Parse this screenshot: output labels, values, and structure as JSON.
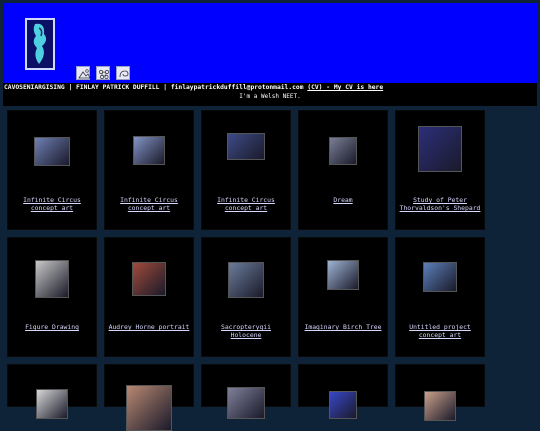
{
  "header": {
    "icons": [
      "landscape-icon",
      "flower-icon",
      "swirl-icon"
    ],
    "info": {
      "site": "CAVOSENIARGISING",
      "sep1": " | ",
      "name": "FINLAY PATRICK DUFFILL",
      "sep2": " | ",
      "email": "finlaypatrickduffill@protonmail.com",
      "cv_link": "(CV) - My CV is here"
    },
    "tagline": "I'm a Welsh NEET."
  },
  "gallery": [
    {
      "caption": "Infinite Circus concept art",
      "thumb_color": "#6e7fb2"
    },
    {
      "caption": "Infinite Circus concept art",
      "thumb_color": "#8393c4"
    },
    {
      "caption": "Infinite Circus concept art",
      "thumb_color": "#3d4b86"
    },
    {
      "caption": "Dream",
      "thumb_color": "#7a7f95"
    },
    {
      "caption": "Study of Peter Thorvaldson's Shepard",
      "thumb_color": "#2c2f7a"
    },
    {
      "caption": "Figure Drawing",
      "thumb_color": "#c9c9c9"
    },
    {
      "caption": "Audrey Horne portrait",
      "thumb_color": "#a04a3a"
    },
    {
      "caption": "Sacropterygii Holocene",
      "thumb_color": "#6a7c9a"
    },
    {
      "caption": "Imaginary Birch Tree",
      "thumb_color": "#9fb4d4"
    },
    {
      "caption": "Untitled project concept art",
      "thumb_color": "#5b7fb8"
    },
    {
      "caption": "",
      "thumb_color": "#d7d7d7"
    },
    {
      "caption": "",
      "thumb_color": "#b88872"
    },
    {
      "caption": "",
      "thumb_color": "#7f7f9a"
    },
    {
      "caption": "",
      "thumb_color": "#3847c8"
    },
    {
      "caption": "",
      "thumb_color": "#c9a08a"
    }
  ]
}
